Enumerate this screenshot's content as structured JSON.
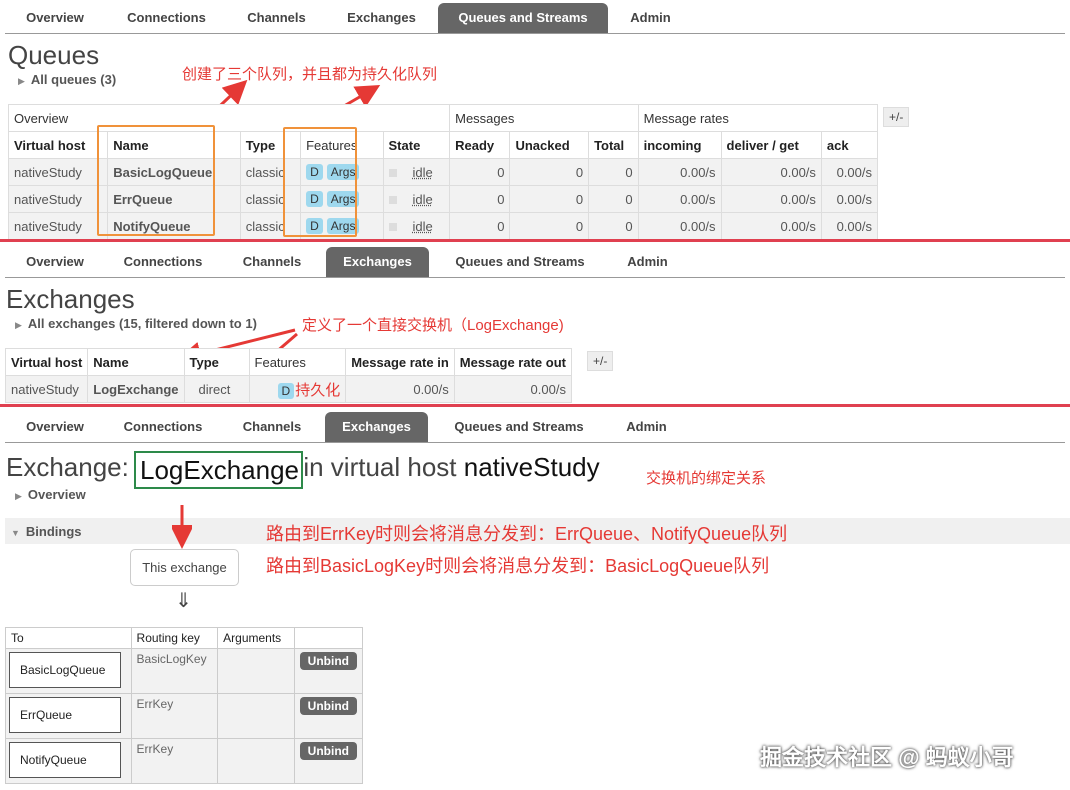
{
  "nav_tabs": [
    "Overview",
    "Connections",
    "Channels",
    "Exchanges",
    "Queues and Streams",
    "Admin"
  ],
  "queues": {
    "title": "Queues",
    "all_label": "All queues (3)",
    "annotation": "创建了三个队列，并且都为持久化队列",
    "group_overview": "Overview",
    "group_messages": "Messages",
    "group_rates": "Message rates",
    "plus_minus": "+/-",
    "headers": [
      "Virtual host",
      "Name",
      "Type",
      "Features",
      "State",
      "Ready",
      "Unacked",
      "Total",
      "incoming",
      "deliver / get",
      "ack"
    ],
    "rows": [
      {
        "vhost": "nativeStudy",
        "name": "BasicLogQueue",
        "type": "classic",
        "f1": "D",
        "f2": "Args",
        "state": "idle",
        "ready": "0",
        "unacked": "0",
        "total": "0",
        "incoming": "0.00/s",
        "deliver": "0.00/s",
        "ack": "0.00/s"
      },
      {
        "vhost": "nativeStudy",
        "name": "ErrQueue",
        "type": "classic",
        "f1": "D",
        "f2": "Args",
        "state": "idle",
        "ready": "0",
        "unacked": "0",
        "total": "0",
        "incoming": "0.00/s",
        "deliver": "0.00/s",
        "ack": "0.00/s"
      },
      {
        "vhost": "nativeStudy",
        "name": "NotifyQueue",
        "type": "classic",
        "f1": "D",
        "f2": "Args",
        "state": "idle",
        "ready": "0",
        "unacked": "0",
        "total": "0",
        "incoming": "0.00/s",
        "deliver": "0.00/s",
        "ack": "0.00/s"
      }
    ]
  },
  "exchanges": {
    "title": "Exchanges",
    "all_label": "All exchanges (15, filtered down to 1)",
    "annotation": "定义了一个直接交换机（LogExchange)",
    "headers": [
      "Virtual host",
      "Name",
      "Type",
      "Features",
      "Message rate in",
      "Message rate out"
    ],
    "plus_minus": "+/-",
    "row": {
      "vhost": "nativeStudy",
      "name": "LogExchange",
      "type": "direct",
      "feature": "D",
      "feature_note": "持久化",
      "rate_in": "0.00/s",
      "rate_out": "0.00/s"
    }
  },
  "exchange_detail": {
    "prefix": "Exchange:",
    "name": "LogExchange",
    "middle": "in virtual host",
    "vhost": "nativeStudy",
    "annotation": "交换机的绑定关系",
    "overview_label": "Overview",
    "bindings_label": "Bindings",
    "note1": "路由到ErrKey时则会将消息分发到：ErrQueue、NotifyQueue队列",
    "note2": "路由到BasicLogKey时则会将消息分发到：BasicLogQueue队列",
    "this_exchange": "This exchange",
    "down_arrow": "⇓",
    "headers": [
      "To",
      "Routing key",
      "Arguments",
      ""
    ],
    "rows": [
      {
        "to": "BasicLogQueue",
        "key": "BasicLogKey",
        "unbind": "Unbind"
      },
      {
        "to": "ErrQueue",
        "key": "ErrKey",
        "unbind": "Unbind"
      },
      {
        "to": "NotifyQueue",
        "key": "ErrKey",
        "unbind": "Unbind"
      }
    ]
  },
  "watermark": "掘金技术社区 @ 蚂蚁小哥",
  "colors": {
    "annotation": "#e53935",
    "orange": "#f0923a",
    "green": "#2d8a4a",
    "nav_active": "#666666",
    "badge": "#9ed8ee"
  }
}
